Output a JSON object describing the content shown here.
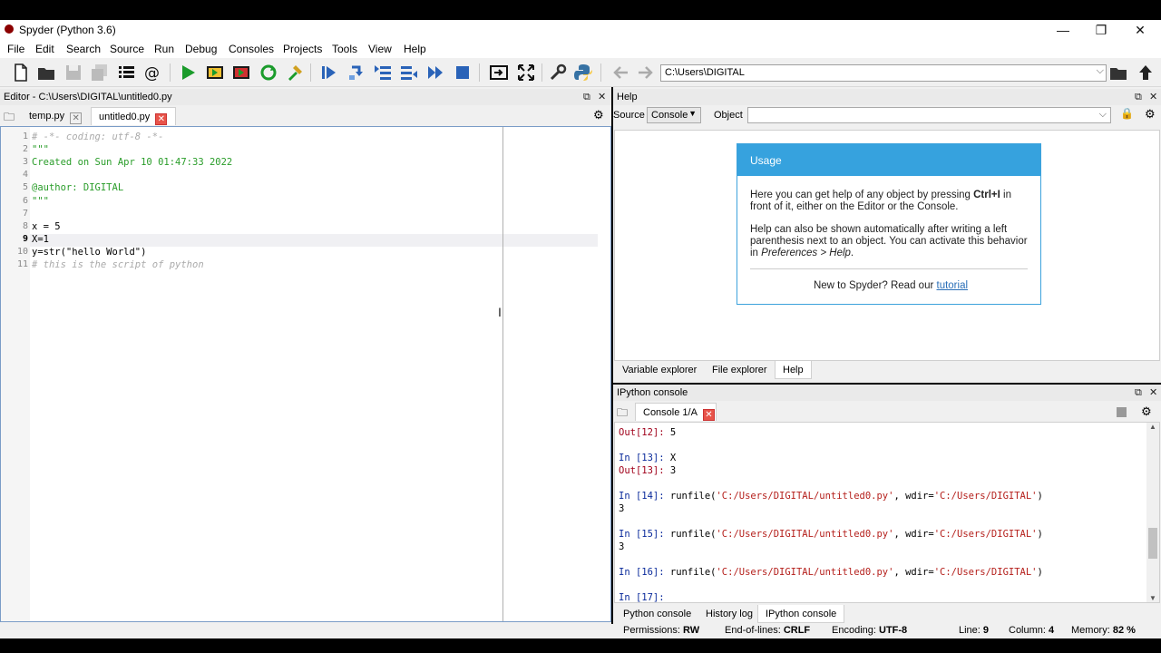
{
  "window": {
    "title": "Spyder (Python 3.6)",
    "minimize": "—",
    "restore": "❐",
    "close": "✕"
  },
  "menu": [
    "File",
    "Edit",
    "Search",
    "Source",
    "Run",
    "Debug",
    "Consoles",
    "Projects",
    "Tools",
    "View",
    "Help"
  ],
  "toolbar": {
    "path": "C:\\Users\\DIGITAL"
  },
  "editor": {
    "title": "Editor - C:\\Users\\DIGITAL\\untitled0.py",
    "tabs": [
      {
        "label": "temp.py"
      },
      {
        "label": "untitled0.py"
      }
    ],
    "lines": [
      {
        "n": "1",
        "text": "# -*- coding: utf-8 -*-",
        "kind": "comment"
      },
      {
        "n": "2",
        "text": "\"\"\"",
        "kind": "str"
      },
      {
        "n": "3",
        "text": "Created on Sun Apr 10 01:47:33 2022",
        "kind": "str"
      },
      {
        "n": "4",
        "text": "",
        "kind": "str"
      },
      {
        "n": "5",
        "text": "@author: DIGITAL",
        "kind": "str"
      },
      {
        "n": "6",
        "text": "\"\"\"",
        "kind": "str"
      },
      {
        "n": "7",
        "text": "",
        "kind": "norm"
      },
      {
        "n": "8",
        "text": "x = 5",
        "kind": "norm"
      },
      {
        "n": "9",
        "text": "X=1",
        "kind": "norm"
      },
      {
        "n": "10",
        "text": "y=str(\"hello World\")",
        "kind": "norm"
      },
      {
        "n": "11",
        "text": "# this is the script of python",
        "kind": "comment"
      }
    ]
  },
  "help": {
    "title": "Help",
    "source_label": "Source",
    "source_value": "Console",
    "object_label": "Object",
    "usage_title": "Usage",
    "usage_p1_a": "Here you can get help of any object by pressing ",
    "usage_p1_key": "Ctrl+I",
    "usage_p1_b": " in front of it, either on the Editor or the Console.",
    "usage_p2_a": "Help can also be shown automatically after writing a left parenthesis next to an object. You can activate this behavior in ",
    "usage_p2_em": "Preferences > Help",
    "usage_p2_b": ".",
    "usage_footer": "New to Spyder? Read our ",
    "usage_link": "tutorial",
    "tabs": [
      "Variable explorer",
      "File explorer",
      "Help"
    ]
  },
  "console": {
    "title": "IPython console",
    "tab": "Console 1/A",
    "lines": [
      {
        "p": "Out[12]: ",
        "t": "5",
        "kind": "out"
      },
      {
        "p": "In [13]: ",
        "t": "X",
        "kind": "in"
      },
      {
        "p": "Out[13]: ",
        "t": "3",
        "kind": "out"
      },
      {
        "p": "In [14]: ",
        "t": "runfile(",
        "s1": "'C:/Users/DIGITAL/untitled0.py'",
        "m": ", wdir=",
        "s2": "'C:/Users/DIGITAL'",
        "e": ")",
        "kind": "run"
      },
      {
        "p": "",
        "t": "3",
        "kind": "plain"
      },
      {
        "p": "In [15]: ",
        "t": "runfile(",
        "s1": "'C:/Users/DIGITAL/untitled0.py'",
        "m": ", wdir=",
        "s2": "'C:/Users/DIGITAL'",
        "e": ")",
        "kind": "run"
      },
      {
        "p": "",
        "t": "3",
        "kind": "plain"
      },
      {
        "p": "In [16]: ",
        "t": "runfile(",
        "s1": "'C:/Users/DIGITAL/untitled0.py'",
        "m": ", wdir=",
        "s2": "'C:/Users/DIGITAL'",
        "e": ")",
        "kind": "run"
      },
      {
        "p": "In [17]: ",
        "t": "",
        "kind": "in"
      }
    ],
    "tabs": [
      "Python console",
      "History log",
      "IPython console"
    ]
  },
  "status": {
    "permissions_label": "Permissions:",
    "permissions": "RW",
    "eol_label": "End-of-lines:",
    "eol": "CRLF",
    "encoding_label": "Encoding:",
    "encoding": "UTF-8",
    "line_label": "Line:",
    "line": "9",
    "column_label": "Column:",
    "column": "4",
    "memory_label": "Memory:",
    "memory": "82 %"
  },
  "colors": {
    "accent": "#36a2de",
    "string": "#2a9d2a",
    "comment": "#aaaaaa",
    "prompt_in": "#0a2a9b",
    "prompt_out": "#a0001a"
  }
}
